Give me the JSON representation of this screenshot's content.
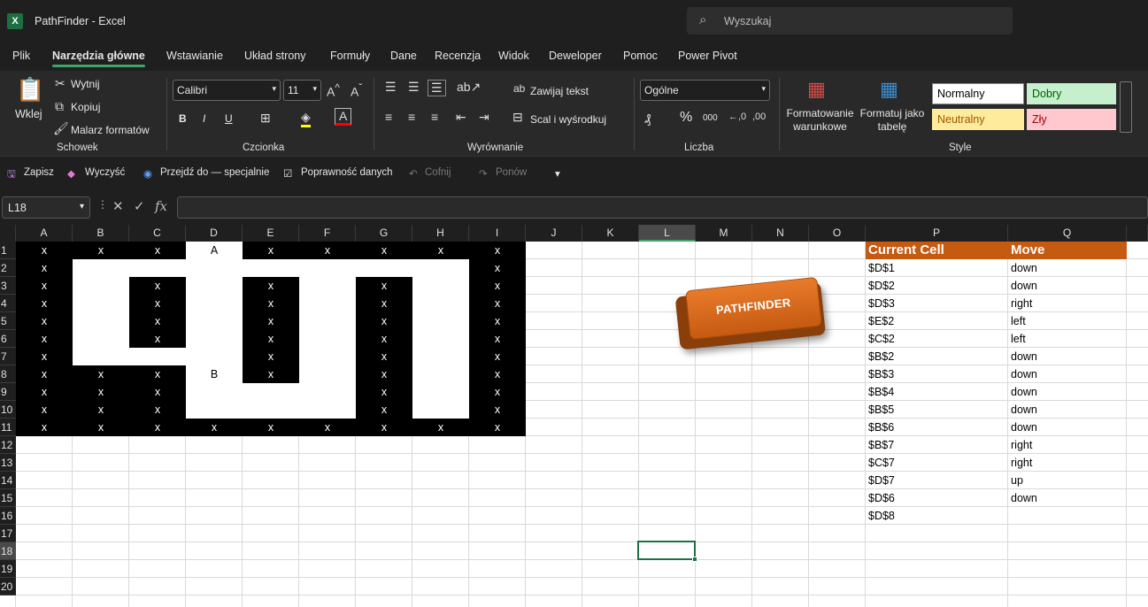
{
  "window": {
    "app_icon": "X",
    "title": "PathFinder  -  Excel"
  },
  "search": {
    "placeholder": "Wyszukaj"
  },
  "menu": [
    "Plik",
    "Narzędzia główne",
    "Wstawianie",
    "Układ strony",
    "Formuły",
    "Dane",
    "Recenzja",
    "Widok",
    "Deweloper",
    "Pomoc",
    "Power Pivot"
  ],
  "ribbon": {
    "clipboard": {
      "paste": "Wklej",
      "cut": "Wytnij",
      "copy": "Kopiuj",
      "painter": "Malarz formatów",
      "group": "Schowek"
    },
    "font": {
      "name": "Calibri",
      "size": "11",
      "bold": "B",
      "italic": "I",
      "underline": "U",
      "group": "Czcionka"
    },
    "alignment": {
      "wrap": "Zawijaj tekst",
      "merge": "Scal i wyśrodkuj",
      "group": "Wyrównanie"
    },
    "number": {
      "format": "Ogólne",
      "percent": "%",
      "thousands": "000",
      "group": "Liczba"
    },
    "styles": {
      "conditional": "Formatowanie warunkowe",
      "table": "Formatuj jako tabelę",
      "normal": "Normalny",
      "good": "Dobry",
      "neutral": "Neutralny",
      "bad": "Zły",
      "group": "Style"
    }
  },
  "qat": {
    "save": "Zapisz",
    "clear": "Wyczyść",
    "goto": "Przejdź do — specjalnie",
    "validation": "Poprawność danych",
    "undo": "Cofnij",
    "redo": "Ponów"
  },
  "formula": {
    "namebox": "L18",
    "fx": "fx",
    "value": ""
  },
  "columns": [
    "A",
    "B",
    "C",
    "D",
    "E",
    "F",
    "G",
    "H",
    "I",
    "J",
    "K",
    "L",
    "M",
    "N",
    "O",
    "P",
    "Q"
  ],
  "selected_column": "L",
  "rows": [
    "1",
    "2",
    "3",
    "4",
    "5",
    "6",
    "7",
    "8",
    "9",
    "10",
    "11",
    "12",
    "13",
    "14",
    "15",
    "16",
    "17",
    "18",
    "19",
    "20"
  ],
  "selected_row": "18",
  "maze": [
    [
      "x",
      "x",
      "x",
      "A",
      "x",
      "x",
      "x",
      "x",
      "x"
    ],
    [
      "x",
      "",
      "",
      "",
      "",
      "",
      "",
      "",
      "x"
    ],
    [
      "x",
      "",
      "x",
      "",
      "x",
      "",
      "x",
      "",
      "x"
    ],
    [
      "x",
      "",
      "x",
      "",
      "x",
      "",
      "x",
      "",
      "x"
    ],
    [
      "x",
      "",
      "x",
      "",
      "x",
      "",
      "x",
      "",
      "x"
    ],
    [
      "x",
      "",
      "x",
      "",
      "x",
      "",
      "x",
      "",
      "x"
    ],
    [
      "x",
      "",
      "",
      "",
      "x",
      "",
      "x",
      "",
      "x"
    ],
    [
      "x",
      "x",
      "x",
      "B",
      "x",
      "",
      "x",
      "",
      "x"
    ],
    [
      "x",
      "x",
      "x",
      "",
      "",
      "",
      "x",
      "",
      "x"
    ],
    [
      "x",
      "x",
      "x",
      "",
      "",
      "",
      "x",
      "",
      "x"
    ],
    [
      "x",
      "x",
      "x",
      "x",
      "x",
      "x",
      "x",
      "x",
      "x"
    ]
  ],
  "path_table": {
    "headers": [
      "Current Cell",
      "Move"
    ],
    "rows": [
      [
        "$D$1",
        "down"
      ],
      [
        "$D$2",
        "down"
      ],
      [
        "$D$3",
        "right"
      ],
      [
        "$E$2",
        "left"
      ],
      [
        "$C$2",
        "left"
      ],
      [
        "$B$2",
        "down"
      ],
      [
        "$B$3",
        "down"
      ],
      [
        "$B$4",
        "down"
      ],
      [
        "$B$5",
        "down"
      ],
      [
        "$B$6",
        "down"
      ],
      [
        "$B$7",
        "right"
      ],
      [
        "$C$7",
        "right"
      ],
      [
        "$D$7",
        "up"
      ],
      [
        "$D$6",
        "down"
      ],
      [
        "$D$8",
        ""
      ]
    ]
  },
  "button": {
    "label": "PATHFINDER"
  },
  "colors": {
    "header_orange": "#c55a11",
    "button_orange": "#e87a2a",
    "accent_green": "#3fa36a"
  }
}
